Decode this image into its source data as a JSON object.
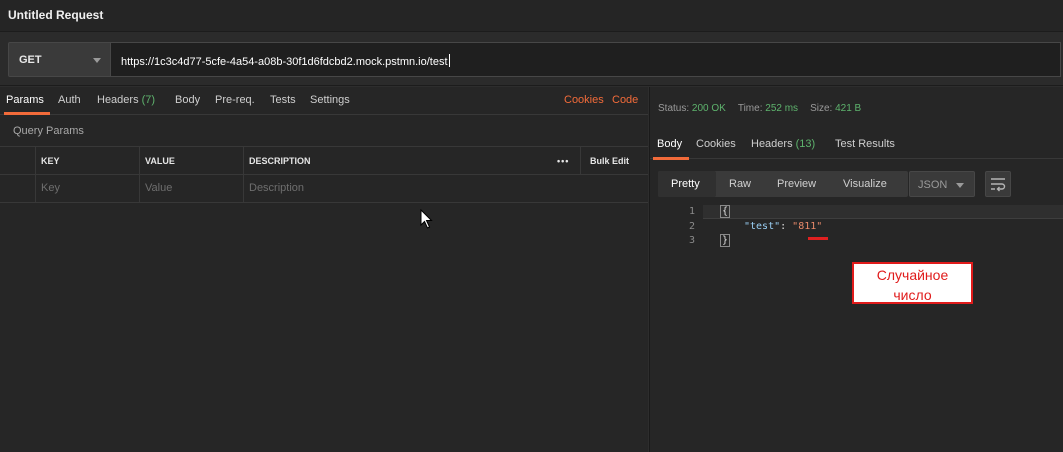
{
  "window": {
    "title": "Untitled Request"
  },
  "request": {
    "method": "GET",
    "url": "https://1c3c4d77-5cfe-4a54-a08b-30f1d6fdcbd2.mock.pstmn.io/test"
  },
  "request_tabs": [
    {
      "label": "Params",
      "count": "",
      "active": true
    },
    {
      "label": "Auth",
      "count": ""
    },
    {
      "label": "Headers",
      "count": "(7)"
    },
    {
      "label": "Body",
      "count": ""
    },
    {
      "label": "Pre-req.",
      "count": ""
    },
    {
      "label": "Tests",
      "count": ""
    },
    {
      "label": "Settings",
      "count": ""
    }
  ],
  "request_links": {
    "cookies": "Cookies",
    "code": "Code"
  },
  "query_params": {
    "title": "Query Params",
    "columns": [
      "KEY",
      "VALUE",
      "DESCRIPTION"
    ],
    "placeholders": [
      "Key",
      "Value",
      "Description"
    ],
    "more": "•••",
    "bulk_edit": "Bulk Edit"
  },
  "response_status": {
    "status_label": "Status:",
    "status_value": "200 OK",
    "time_label": "Time:",
    "time_value": "252 ms",
    "size_label": "Size:",
    "size_value": "421 B"
  },
  "response_tabs": [
    {
      "label": "Body",
      "count": "",
      "active": true
    },
    {
      "label": "Cookies",
      "count": ""
    },
    {
      "label": "Headers",
      "count": "(13)"
    },
    {
      "label": "Test Results",
      "count": ""
    }
  ],
  "view_modes": [
    "Pretty",
    "Raw",
    "Preview",
    "Visualize"
  ],
  "format": "JSON",
  "body": {
    "line_numbers": [
      "1",
      "2",
      "3"
    ],
    "open_brace": "{",
    "key": "\"test\"",
    "separator": ": ",
    "value": "\"811\"",
    "close_brace": "}"
  },
  "annotation": {
    "line1": "Случайное",
    "line2": "число"
  },
  "colors": {
    "accent": "#f26b3a",
    "success": "#5eb36d",
    "annotation": "#e01b1b"
  },
  "icons": [
    "chevron-down-icon",
    "more-icon",
    "wrap-lines-icon",
    "mouse-pointer-icon"
  ]
}
